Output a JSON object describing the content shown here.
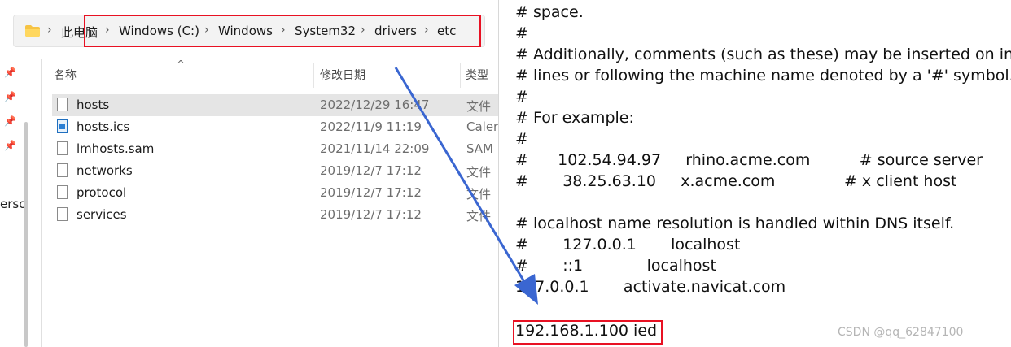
{
  "breadcrumb": {
    "items": [
      "此电脑",
      "Windows (C:)",
      "Windows",
      "System32",
      "drivers",
      "etc"
    ]
  },
  "nav": {
    "cut_label": "erso"
  },
  "columns": {
    "name": "名称",
    "date": "修改日期",
    "type": "类型"
  },
  "files": [
    {
      "name": "hosts",
      "date": "2022/12/29 16:47",
      "type": "文件",
      "icon": "file-icon",
      "selected": true
    },
    {
      "name": "hosts.ics",
      "date": "2022/11/9 11:19",
      "type": "Calen",
      "icon": "calendar-file-icon"
    },
    {
      "name": "lmhosts.sam",
      "date": "2021/11/14 22:09",
      "type": "SAM",
      "icon": "file-icon"
    },
    {
      "name": "networks",
      "date": "2019/12/7 17:12",
      "type": "文件",
      "icon": "file-icon"
    },
    {
      "name": "protocol",
      "date": "2019/12/7 17:12",
      "type": "文件",
      "icon": "file-icon"
    },
    {
      "name": "services",
      "date": "2019/12/7 17:12",
      "type": "文件",
      "icon": "file-icon"
    }
  ],
  "hosts_lines": [
    "# space.",
    "#",
    "# Additionally, comments (such as these) may be inserted on ind",
    "# lines or following the machine name denoted by a '#' symbol.",
    "#",
    "# For example:",
    "#",
    "#      102.54.94.97     rhino.acme.com          # source server",
    "#       38.25.63.10     x.acme.com              # x client host",
    "",
    "# localhost name resolution is handled within DNS itself.",
    "#       127.0.0.1       localhost",
    "#       ::1             localhost",
    "127.0.0.1       activate.navicat.com",
    "",
    "192.168.1.100 ied"
  ],
  "watermark": "CSDN @qq_62847100",
  "colors": {
    "highlight": "#e81123",
    "arrow": "#3a66d1"
  }
}
